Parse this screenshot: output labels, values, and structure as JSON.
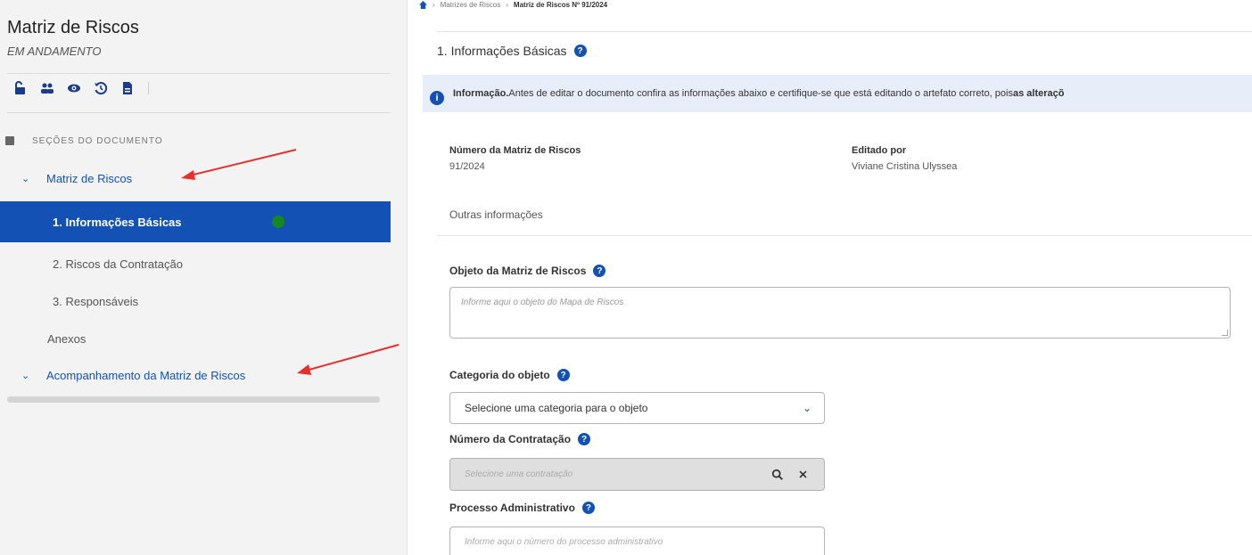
{
  "sidebar": {
    "title": "Matriz de Riscos",
    "status": "EM ANDAMENTO",
    "toolbar": {
      "icons": [
        "unlock-icon",
        "users-icon",
        "eye-icon",
        "history-icon",
        "document-icon"
      ]
    },
    "sections_label": "SEÇÕES DO DOCUMENTO",
    "groups": [
      {
        "label": "Matriz de Riscos",
        "icon": "chevron-down-icon"
      },
      {
        "label": "Acompanhamento da Matriz de Riscos",
        "icon": "chevron-down-icon"
      }
    ],
    "items": [
      {
        "label": "1. Informações Básicas",
        "active": true,
        "status": "complete"
      },
      {
        "label": "2. Riscos da Contratação"
      },
      {
        "label": "3. Responsáveis"
      },
      {
        "label": "Anexos"
      }
    ]
  },
  "breadcrumb": {
    "home_icon": "home-icon",
    "items": [
      "Matrizes de Riscos",
      "Matriz de Riscos Nº 91/2024"
    ]
  },
  "main": {
    "section_title": "1. Informações Básicas",
    "info": {
      "lead": "Informação.",
      "text": " Antes de editar o documento confira as informações abaixo e certifique-se que está editando o artefato correto, pois ",
      "emphasis": "as alteraçõ"
    },
    "fields": {
      "numero_label": "Número da Matriz de Riscos",
      "numero_value": "91/2024",
      "editado_label": "Editado por",
      "editado_value": "Viviane Cristina Ulyssea"
    },
    "other_info": "Outras informações",
    "objeto": {
      "label": "Objeto da Matriz de Riscos",
      "placeholder": "Informe aqui o objeto do Mapa de Riscos"
    },
    "categoria": {
      "label": "Categoria do objeto",
      "selected": "Selecione uma categoria para o objeto"
    },
    "contratacao": {
      "label": "Número da Contratação",
      "placeholder": "Selecione uma contratação"
    },
    "processo": {
      "label": "Processo Administrativo",
      "placeholder": "Informe aqui o número do processo administrativo"
    }
  },
  "colors": {
    "primary": "#1351b4",
    "success": "#168821",
    "annotation": "#e53030"
  }
}
